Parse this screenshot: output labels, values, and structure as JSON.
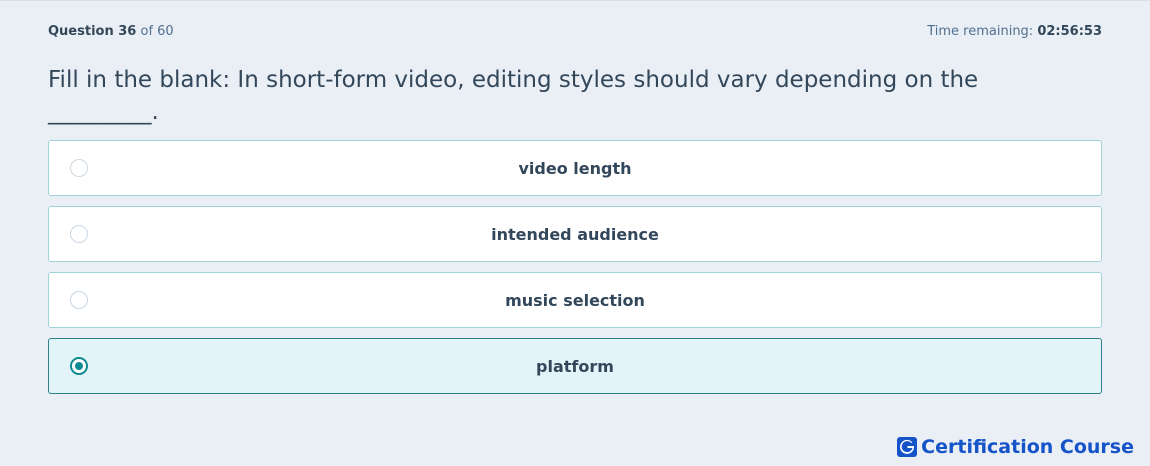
{
  "header": {
    "question_word": "Question 36",
    "question_of": "of 60",
    "time_label": "Time remaining:",
    "time_value": "02:56:53"
  },
  "question": {
    "text": "Fill in the blank: In short-form video, editing styles should vary depending on the _________."
  },
  "options": [
    {
      "label": "video length",
      "selected": false
    },
    {
      "label": "intended audience",
      "selected": false
    },
    {
      "label": "music selection",
      "selected": false
    },
    {
      "label": "platform",
      "selected": true
    }
  ],
  "brand": {
    "name": "Certification Course",
    "logo_letter": "G",
    "color": "#1554c8"
  },
  "colors": {
    "accent": "#0b8a8f",
    "selected_bg": "#e3f4f8",
    "border": "#9fd3d8",
    "background": "#eaeff6"
  }
}
